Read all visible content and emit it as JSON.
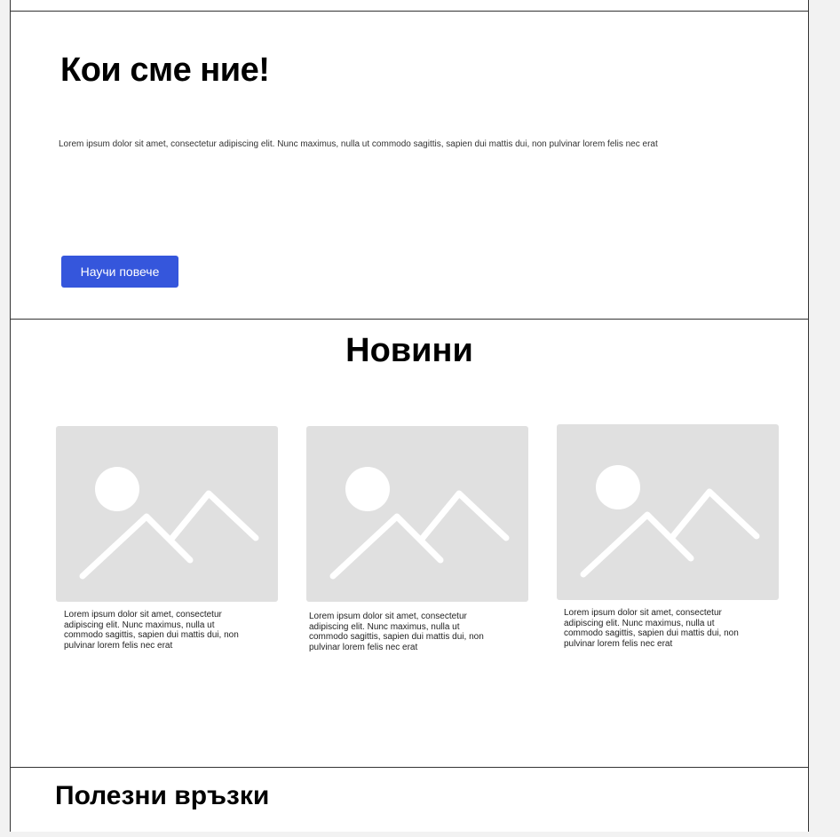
{
  "about": {
    "title": "Кои сме ние!",
    "text": "Lorem ipsum dolor sit amet, consectetur adipiscing elit. Nunc maximus, nulla ut commodo sagittis, sapien dui mattis dui, non pulvinar lorem felis nec erat",
    "button_label": "Научи повече"
  },
  "news": {
    "title": "Новини",
    "cards": [
      {
        "image_icon": "image-placeholder-icon",
        "text": "Lorem ipsum dolor sit amet, consectetur adipiscing elit. Nunc maximus, nulla ut commodo sagittis, sapien dui mattis dui, non pulvinar lorem felis nec erat"
      },
      {
        "image_icon": "image-placeholder-icon",
        "text": "Lorem ipsum dolor sit amet, consectetur adipiscing elit. Nunc maximus, nulla ut commodo sagittis, sapien dui mattis dui, non pulvinar lorem felis nec erat"
      },
      {
        "image_icon": "image-placeholder-icon",
        "text": "Lorem ipsum dolor sit amet, consectetur adipiscing elit. Nunc maximus, nulla ut commodo sagittis, sapien dui mattis dui, non pulvinar lorem felis nec erat"
      }
    ]
  },
  "links": {
    "title": "Полезни връзки"
  },
  "colors": {
    "button": "#3556dc",
    "placeholder_bg": "#e0e0e0",
    "border": "#333333"
  }
}
